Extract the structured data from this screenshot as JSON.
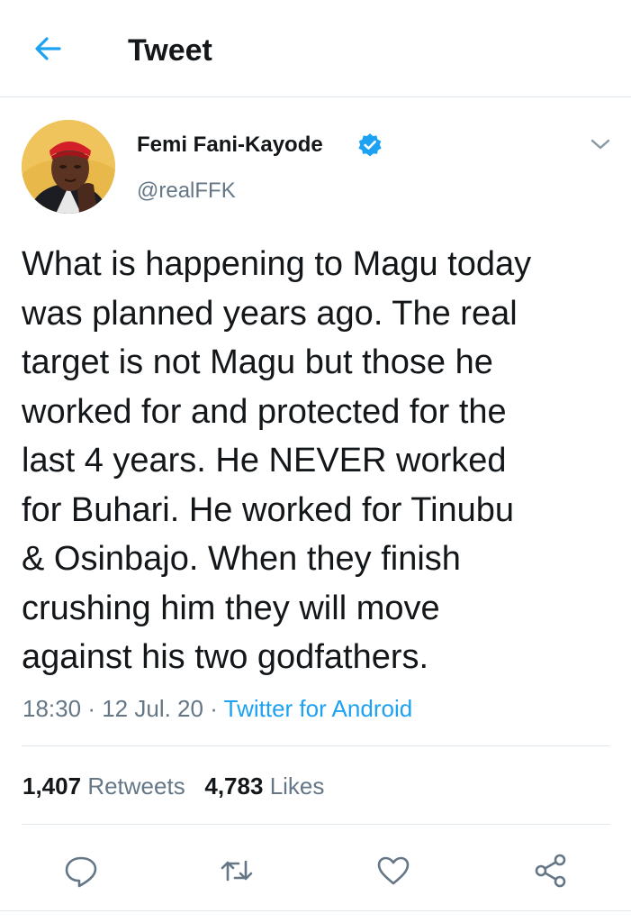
{
  "header": {
    "title": "Tweet",
    "back_icon": "arrow-left-icon"
  },
  "tweet": {
    "author": {
      "name": "Femi Fani-Kayode",
      "handle": "@realFFK",
      "verified": true
    },
    "text": "What is happening to Magu today\nwas planned years ago. The real\ntarget is not Magu but those he\nworked for and protected for the\nlast 4 years. He NEVER worked\nfor Buhari. He worked for Tinubu\n& Osinbajo. When they finish\ncrushing him they will move\nagainst his two godfathers.",
    "time": "18:30",
    "separator": "·",
    "date": "12 Jul. 20",
    "source": "Twitter for Android",
    "retweets_count": "1,407",
    "retweets_label": "Retweets",
    "likes_count": "4,783",
    "likes_label": "Likes"
  },
  "actions": [
    "reply-icon",
    "retweet-icon",
    "like-icon",
    "share-icon"
  ],
  "colors": {
    "accent": "#1da1f2",
    "text": "#14171a",
    "secondary": "#657786",
    "divider": "#e1e8ed"
  }
}
